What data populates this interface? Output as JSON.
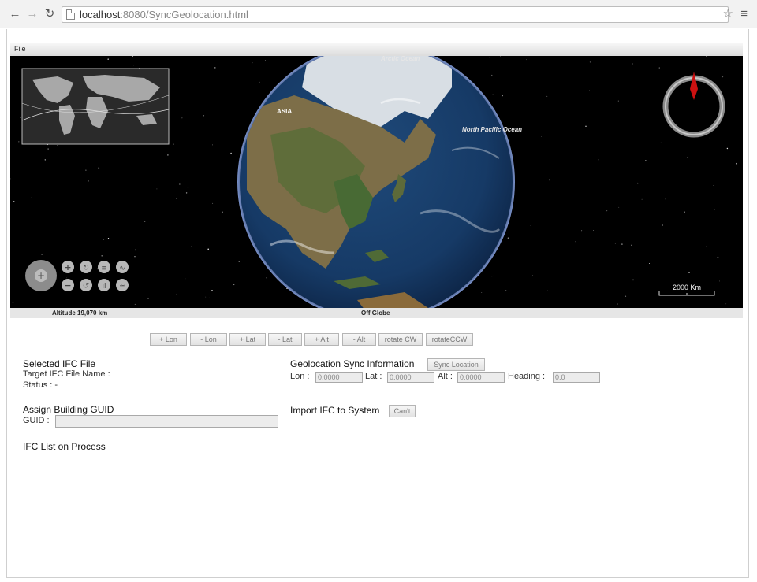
{
  "browser": {
    "back_icon": "back-arrow-icon",
    "forward_icon": "forward-arrow-icon",
    "reload_icon": "reload-icon",
    "url_host": "localhost",
    "url_path": ":8080/SyncGeolocation.html",
    "bookmark_icon": "star-icon",
    "menu_icon": "hamburger-menu-icon"
  },
  "menu": {
    "file": "File"
  },
  "globe": {
    "labels": {
      "arctic": "Arctic Ocean",
      "asia": "ASIA",
      "pacific": "North Pacific Ocean"
    },
    "scale_label": "2000 Km",
    "altitude": "Altitude  19,070 km",
    "position": "Off Globe",
    "compass_icon": "compass-icon",
    "world_map_icon": "world-overview-map"
  },
  "controls": [
    {
      "label": "+ Lon"
    },
    {
      "label": "- Lon"
    },
    {
      "label": "+ Lat"
    },
    {
      "label": "- Lat"
    },
    {
      "label": "+ Alt"
    },
    {
      "label": "- Alt"
    },
    {
      "label": "rotate CW"
    },
    {
      "label": "rotateCCW"
    }
  ],
  "selected_ifc": {
    "title": "Selected IFC File",
    "target_label": "Target IFC File Name :",
    "status_label": "Status : -"
  },
  "geolocation": {
    "title": "Geolocation Sync Information",
    "sync_button": "Sync Location",
    "lon_label": "Lon :",
    "lon_value": "0.0000",
    "lat_label": "Lat :",
    "lat_value": "0.0000",
    "alt_label": "Alt :",
    "alt_value": "0.0000",
    "heading_label": "Heading :",
    "heading_value": "0.0"
  },
  "assign_guid": {
    "title": "Assign Building GUID",
    "guid_label": "GUID :",
    "guid_value": ""
  },
  "import_ifc": {
    "title": "Import IFC to System",
    "button": "Can't"
  },
  "ifc_list": {
    "title": "IFC List on Process"
  },
  "colors": {
    "space": "#000000",
    "ocean": "#16365e",
    "land": "#8a7a52",
    "snow": "#e8eef2",
    "compass_needle": "#cc1111"
  }
}
